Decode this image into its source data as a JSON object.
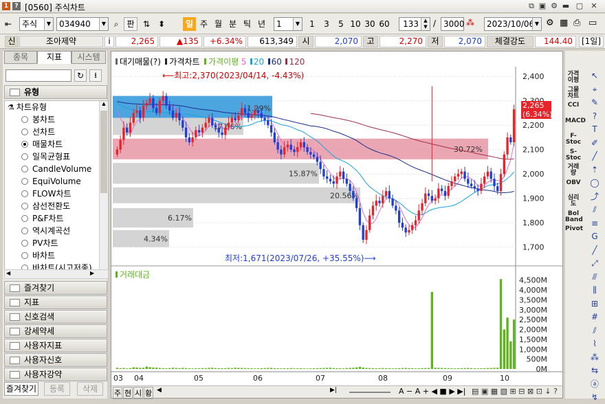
{
  "window": {
    "title": "[0560] 주식차트",
    "badge_1": "1",
    "badge_2": "?"
  },
  "toolbar": {
    "market": "주식",
    "code": "034940",
    "lookup": "판",
    "periods": [
      "일",
      "주",
      "월",
      "분",
      "틱",
      "년"
    ],
    "active_period": "일",
    "unit": "1",
    "tick_buttons": [
      "1",
      "3",
      "5",
      "10",
      "30",
      "60"
    ],
    "count": "133",
    "count_sep": "/",
    "max_count": "3000",
    "date": "2023/10/06"
  },
  "info": {
    "badge": "신",
    "name": "조아제약",
    "info_btn": "i",
    "price": "2,265",
    "change": "▲135",
    "change_pct": "+6.34%",
    "volume": "613,349",
    "open_label": "시",
    "open": "2,070",
    "high_label": "고",
    "high": "2,270",
    "low_label": "저",
    "low": "2,070",
    "strength_label": "체결강도",
    "strength": "144.40",
    "period_badge": "[1일]"
  },
  "leftpanel": {
    "tabs": [
      "종목",
      "지표",
      "시스템"
    ],
    "active_tab": "지표",
    "header": "유형",
    "group": "차트유형",
    "items": [
      {
        "label": "봉차트",
        "selected": false
      },
      {
        "label": "선차트",
        "selected": false
      },
      {
        "label": "매물차트",
        "selected": true
      },
      {
        "label": "일목균형표",
        "selected": false
      },
      {
        "label": "CandleVolume",
        "selected": false
      },
      {
        "label": "EquiVolume",
        "selected": false
      },
      {
        "label": "FLOW차트",
        "selected": false
      },
      {
        "label": "삼선전환도",
        "selected": false
      },
      {
        "label": "P&F차트",
        "selected": false
      },
      {
        "label": "역시계곡선",
        "selected": false
      },
      {
        "label": "PV차트",
        "selected": false
      },
      {
        "label": "바차트",
        "selected": false
      },
      {
        "label": "바차트(시고저종)",
        "selected": false
      }
    ],
    "categories": [
      "즐겨찾기",
      "지표",
      "신호검색",
      "강세약세",
      "사용자지표",
      "사용자신호",
      "사용자강약"
    ],
    "bottom_tabs": [
      "즐겨찾기",
      "등록",
      "삭제"
    ]
  },
  "chart": {
    "legend": [
      "대기매물(?)",
      "가격차트",
      "가격이평",
      "5",
      "20",
      "60",
      "120"
    ],
    "volume_legend": "거래대금",
    "high_annotation": "⟵최고:2,370(2023/04/14, -4.43%)",
    "low_annotation": "최저:1,671(2023/07/26, +35.55%)⟶",
    "price_tag": "2,265",
    "price_tag_pct": "(6.34%)",
    "bottom_controls": [
      "주",
      "현",
      "시",
      "황"
    ]
  },
  "rightbar": {
    "indicators": [
      "가격이평",
      "그물차트",
      "CCI",
      "MACD",
      "F-Stoc",
      "S-Stoc",
      "거래량",
      "OBV",
      "심리도",
      "Bol Band",
      "Pivot"
    ]
  },
  "colors": {
    "up": "#e8242a",
    "down": "#1f3fd6",
    "ma5": "#e86ad0",
    "ma20": "#1aa3e0",
    "ma60": "#1a2f8c",
    "ma120": "#a0304a",
    "volume": "#5fb41e",
    "band_blue": "#3a9bdc",
    "band_red": "#e38a99"
  },
  "chart_data": {
    "type": "candlestick",
    "title": "",
    "x_ticks": [
      "03",
      "04",
      "05",
      "06",
      "07",
      "08",
      "09",
      "10"
    ],
    "y_ticks": [
      1700,
      1800,
      1900,
      2000,
      2100,
      2200,
      2300,
      2400
    ],
    "ylim": [
      1640,
      2440
    ],
    "volume_ticks": [
      "0M",
      "500M",
      "1,000M",
      "1,500M",
      "2,000M",
      "2,500M",
      "3,000M",
      "3,500M",
      "4,000M",
      "4,500M"
    ],
    "volume_ylim": [
      0,
      4800
    ],
    "volume_profile": [
      {
        "low": 2230,
        "high": 2320,
        "pct": null
      },
      {
        "low": 2160,
        "high": 2230,
        "pct": "17.06%"
      },
      {
        "low": 2060,
        "high": 2145,
        "pct": "30.72%"
      },
      {
        "low": 1960,
        "high": 2045,
        "pct": "15.87%"
      },
      {
        "low": 1880,
        "high": 1945,
        "pct": "20.56%"
      },
      {
        "low": 1780,
        "high": 1860,
        "pct": "6.17%"
      },
      {
        "low": 1700,
        "high": 1770,
        "pct": "4.34%"
      }
    ],
    "profile_top_label": "1.29%",
    "closes": [
      2100,
      2140,
      2190,
      2170,
      2210,
      2250,
      2260,
      2230,
      2280,
      2290,
      2310,
      2270,
      2250,
      2300,
      2320,
      2280,
      2260,
      2230,
      2250,
      2220,
      2190,
      2150,
      2130,
      2150,
      2180,
      2170,
      2190,
      2210,
      2230,
      2200,
      2190,
      2170,
      2160,
      2190,
      2210,
      2230,
      2220,
      2240,
      2270,
      2250,
      2230,
      2240,
      2260,
      2250,
      2230,
      2220,
      2200,
      2170,
      2130,
      2100,
      2080,
      2110,
      2120,
      2100,
      2090,
      2110,
      2130,
      2110,
      2090,
      2080,
      2070,
      2050,
      2020,
      1990,
      1980,
      1970,
      1960,
      1990,
      2010,
      1980,
      1960,
      1930,
      1900,
      1860,
      1790,
      1730,
      1770,
      1830,
      1870,
      1890,
      1880,
      1910,
      1930,
      1900,
      1870,
      1850,
      1800,
      1780,
      1760,
      1770,
      1790,
      1810,
      1850,
      1880,
      1920,
      1910,
      1890,
      1900,
      1940,
      1930,
      1910,
      1950,
      1970,
      1990,
      2000,
      2010,
      1980,
      1960,
      1950,
      1940,
      1930,
      1960,
      1990,
      2010,
      1980,
      1950,
      1930,
      2000,
      2080,
      2150,
      2130,
      2265
    ],
    "volumes": [
      60,
      40,
      50,
      30,
      45,
      80,
      70,
      55,
      60,
      120,
      90,
      70,
      65,
      50,
      40,
      35,
      45,
      60,
      50,
      40,
      55,
      45,
      35,
      30,
      40,
      35,
      45,
      40,
      55,
      60,
      45,
      40,
      35,
      40,
      50,
      45,
      60,
      55,
      50,
      45,
      40,
      35,
      30,
      35,
      40,
      45,
      50,
      55,
      40,
      35,
      30,
      35,
      40,
      45,
      30,
      35,
      40,
      30,
      25,
      30,
      35,
      40,
      45,
      50,
      55,
      60,
      45,
      40,
      35,
      30,
      45,
      55,
      60,
      80,
      110,
      70,
      50,
      45,
      40,
      35,
      40,
      45,
      40,
      35,
      30,
      35,
      40,
      45,
      50,
      40,
      35,
      30,
      35,
      40,
      45,
      50,
      3900,
      60,
      55,
      50,
      45,
      40,
      35,
      30,
      35,
      40,
      45,
      50,
      40,
      35,
      30,
      35,
      40,
      45,
      50,
      55,
      60,
      4550,
      2000,
      2600,
      1400,
      2500
    ]
  }
}
